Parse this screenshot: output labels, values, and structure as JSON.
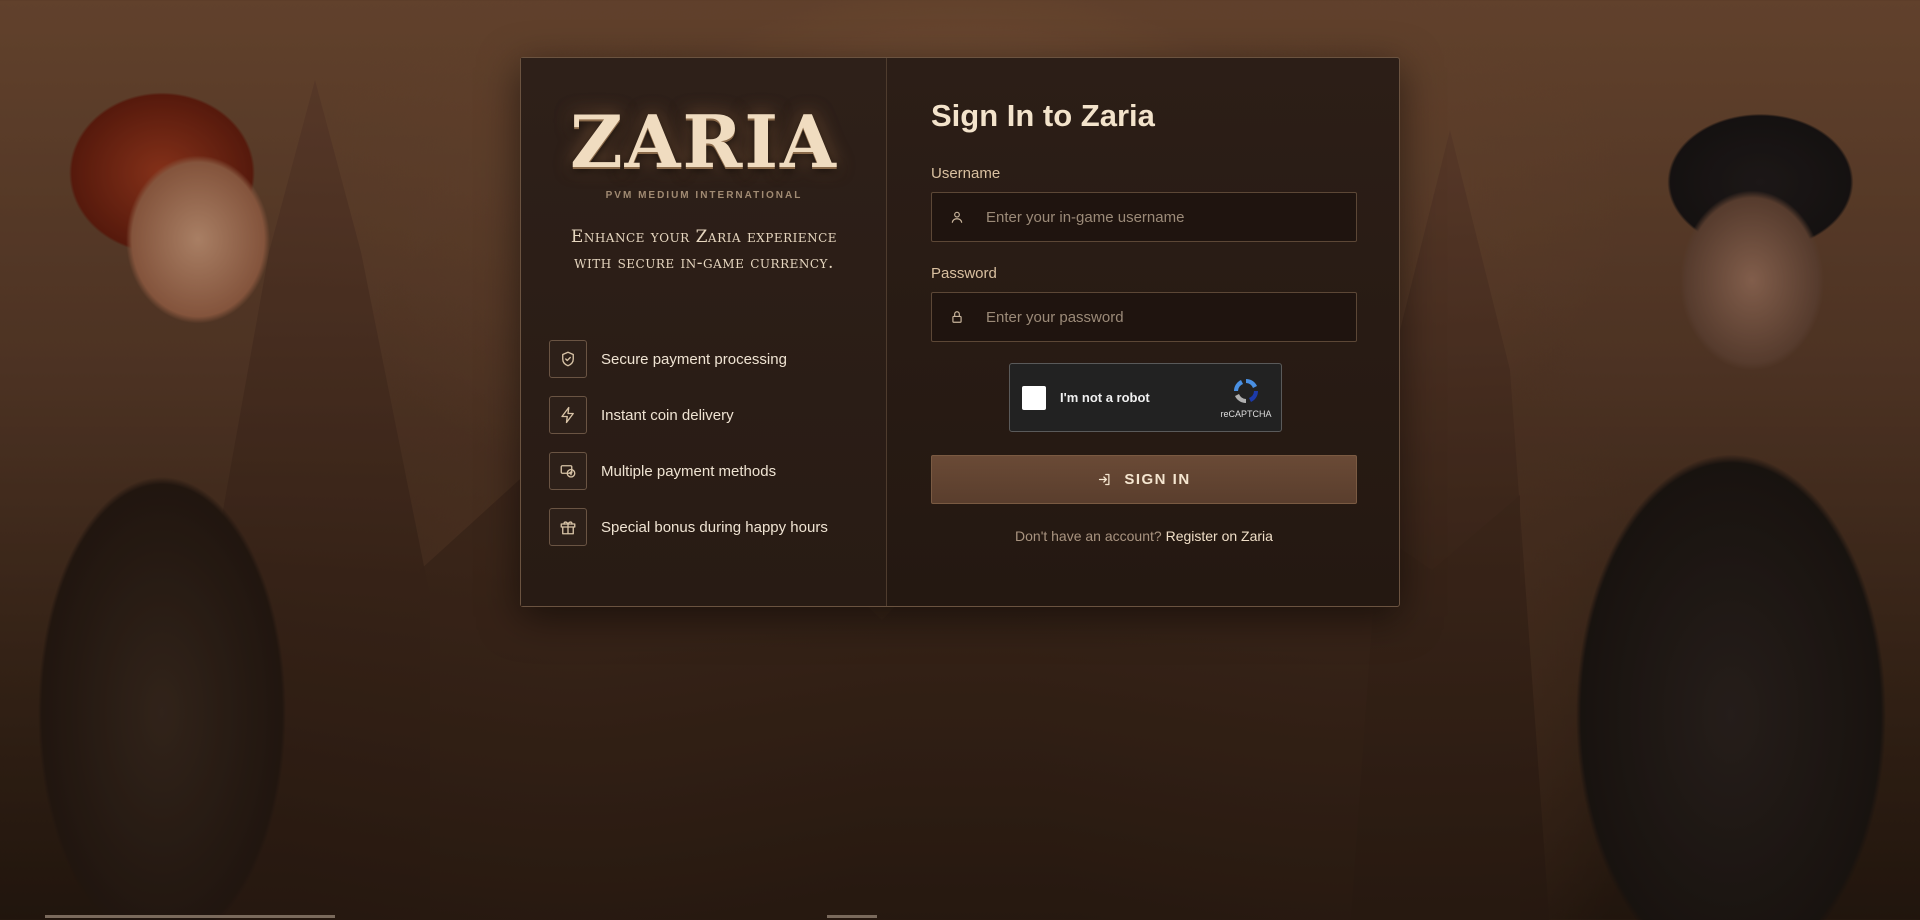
{
  "brand": {
    "logo": "ZARIA",
    "logo_sub": "PVM MEDIUM INTERNATIONAL",
    "tagline_line1": "Enhance your Zaria experience",
    "tagline_line2": "with secure in-game currency."
  },
  "features": [
    {
      "icon": "shield-check-icon",
      "label": "Secure payment processing"
    },
    {
      "icon": "lightning-icon",
      "label": "Instant coin delivery"
    },
    {
      "icon": "payment-methods-icon",
      "label": "Multiple payment methods"
    },
    {
      "icon": "gift-icon",
      "label": "Special bonus during happy hours"
    }
  ],
  "form": {
    "title": "Sign In to Zaria",
    "username_label": "Username",
    "username_placeholder": "Enter your in-game username",
    "password_label": "Password",
    "password_placeholder": "Enter your password",
    "captcha_text": "I'm not a robot",
    "captcha_brand": "reCAPTCHA",
    "signin_label": "SIGN IN",
    "register_prompt": "Don't have an account?",
    "register_link": "Register on Zaria"
  },
  "colors": {
    "accent": "#f3e3cb",
    "button": "#5a3e2d",
    "border": "#6b5340"
  }
}
